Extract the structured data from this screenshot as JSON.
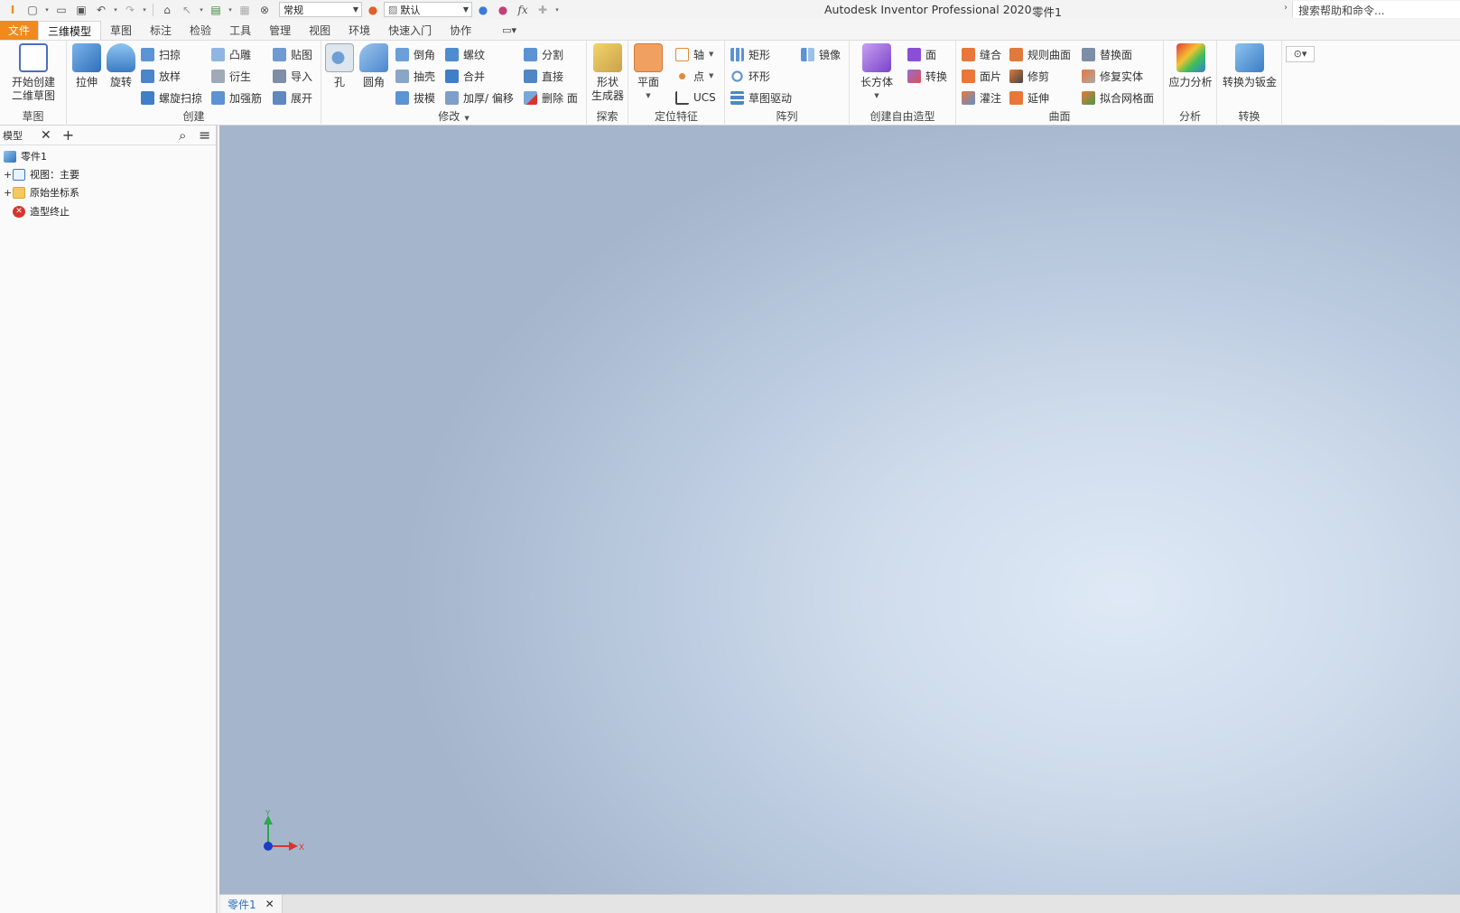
{
  "titlebar": {
    "app_title": "Autodesk Inventor Professional 2020",
    "document": "零件1",
    "appearance_combo": "常规",
    "material_combo": "默认",
    "search_placeholder": "搜索帮助和命令..."
  },
  "tabs": {
    "file": "文件",
    "items": [
      "三维模型",
      "草图",
      "标注",
      "检验",
      "工具",
      "管理",
      "视图",
      "环境",
      "快速入门",
      "协作"
    ],
    "active": "三维模型"
  },
  "ribbon": {
    "sketch": {
      "title": "草图",
      "start_sketch": "开始创建\n二维草图"
    },
    "create": {
      "title": "创建",
      "extrude": "拉伸",
      "revolve": "旋转",
      "sweep": "扫掠",
      "loft": "放样",
      "coil": "螺旋扫掠",
      "emboss": "凸雕",
      "derive": "衍生",
      "rib": "加强筋",
      "decal": "贴图",
      "import": "导入",
      "unwrap": "展开"
    },
    "modify": {
      "title": "修改",
      "hole": "孔",
      "fillet": "圆角",
      "chamfer": "倒角",
      "shell": "抽壳",
      "draft": "拔模",
      "thread": "螺纹",
      "combine": "合并",
      "thicken": "加厚/ 偏移",
      "split": "分割",
      "direct": "直接",
      "delete_face": "删除 面"
    },
    "explore": {
      "title": "探索",
      "shape_generator": "形状\n生成器"
    },
    "work_features": {
      "title": "定位特征",
      "plane": "平面",
      "axis": "轴",
      "point": "点",
      "ucs": "UCS"
    },
    "pattern": {
      "title": "阵列",
      "rectangular": "矩形",
      "circular": "环形",
      "sketch_driven": "草图驱动",
      "mirror": "镜像"
    },
    "freeform": {
      "title": "创建自由造型",
      "box": "长方体",
      "face": "面",
      "convert": "转换"
    },
    "surface": {
      "title": "曲面",
      "stitch": "缝合",
      "patch": "面片",
      "sculpt": "灌注",
      "ruled": "规则曲面",
      "trim": "修剪",
      "extend": "延伸",
      "replace_face": "替换面",
      "repair": "修复实体",
      "fit_mesh": "拟合网格面"
    },
    "analysis": {
      "title": "分析",
      "stress": "应力分析"
    },
    "convert": {
      "title": "转换",
      "to_sheet_metal": "转换为钣金"
    }
  },
  "browser": {
    "tab": "模型",
    "tree": [
      {
        "label": "零件1",
        "icon": "part-icon"
      },
      {
        "label": "视图：主要",
        "icon": "view-icon"
      },
      {
        "label": "原始坐标系",
        "icon": "folder-icon"
      },
      {
        "label": "造型终止",
        "icon": "end-of-part-icon"
      }
    ]
  },
  "viewport": {
    "triad_x": "X",
    "triad_y": "Y"
  },
  "doctabs": {
    "items": [
      "零件1"
    ]
  },
  "colors": {
    "file_tab": "#f08a1c",
    "active_doc": "#2d6fc4",
    "viewport_center": "#dfe9f6",
    "viewport_edge": "#a4b5cc"
  }
}
